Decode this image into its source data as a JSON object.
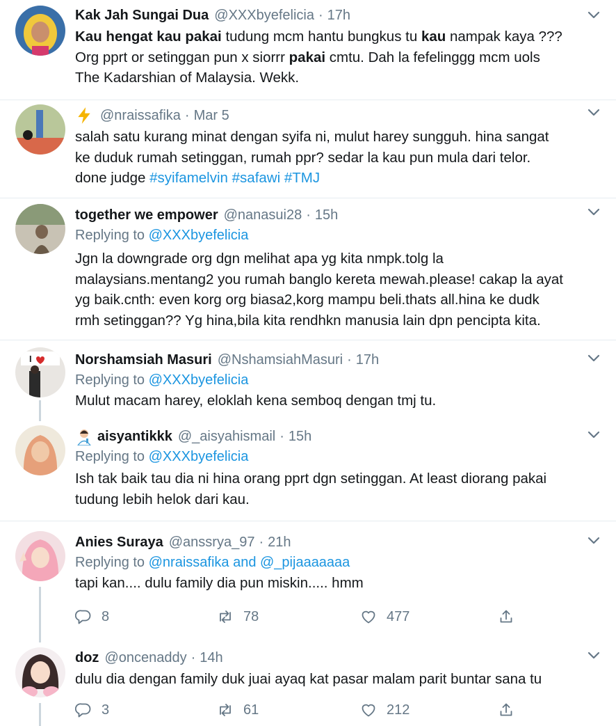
{
  "colors": {
    "link": "#1b95e0",
    "muted": "#657786",
    "text": "#14171a",
    "divider": "#e6ecf0"
  },
  "tweets": [
    {
      "name": "Kak Jah Sungai Dua",
      "handle": "@XXXbyefelicia",
      "sep": "·",
      "time": "17h",
      "text_parts": [
        "Kau hengat kau pakai",
        " tudung mcm hantu bungkus tu ",
        "kau",
        " nampak kaya ???",
        "Org pprt or setinggan pun x siorrr ",
        "pakai",
        " cmtu. Dah la fefelinggg mcm uols",
        "The Kadarshian of Malaysia. Wekk."
      ]
    },
    {
      "name_icon": "lightning-emoji",
      "handle": "@nraissafika",
      "sep": "·",
      "time": "Mar 5",
      "lines": [
        "salah satu kurang minat dengan syifa ni, mulut harey sungguh. hina sangat",
        "ke duduk rumah setinggan, rumah ppr? sedar la kau pun mula dari telor.",
        "done judge "
      ],
      "hashtags": [
        "#syifamelvin",
        "#safawi",
        "#TMJ"
      ]
    },
    {
      "name": "together we empower",
      "handle": "@nanasui28",
      "sep": "·",
      "time": "15h",
      "reply_prefix": "Replying to",
      "reply_to": "@XXXbyefelicia",
      "lines": [
        "Jgn la downgrade org dgn melihat apa yg kita nmpk.tolg la",
        "malaysians.mentang2 you rumah banglo kereta mewah.please! cakap la ayat",
        "yg baik.cnth: even korg org biasa2,korg mampu beli.thats all.hina ke dudk",
        "rmh setinggan?? Yg hina,bila kita rendhkn manusia lain dpn pencipta kita."
      ]
    },
    {
      "name": "Norshamsiah Masuri",
      "handle": "@NshamsiahMasuri",
      "sep": "·",
      "time": "17h",
      "reply_prefix": "Replying to",
      "reply_to": "@XXXbyefelicia",
      "lines": [
        "Mulut macam harey, eloklah kena semboq dengan tmj tu."
      ]
    },
    {
      "name_icon": "scientist-emoji",
      "name": "aisyantikkk",
      "handle": "@_aisyahismail",
      "sep": "·",
      "time": "15h",
      "reply_prefix": "Replying to",
      "reply_to": "@XXXbyefelicia",
      "lines": [
        "Ish tak baik tau dia ni hina orang pprt dgn setinggan. At least diorang pakai",
        "tudung lebih helok dari kau."
      ]
    },
    {
      "name": "Anies Suraya",
      "handle": "@anssrya_97",
      "sep": "·",
      "time": "21h",
      "reply_prefix": "Replying to",
      "reply_to": "@nraissafika and @_pijaaaaaaa",
      "lines": [
        "tapi kan.... dulu family dia pun miskin..... hmm"
      ],
      "stats": {
        "replies": "8",
        "retweets": "78",
        "likes": "477"
      }
    },
    {
      "name": "doz",
      "handle": "@oncenaddy",
      "sep": "·",
      "time": "14h",
      "lines": [
        "dulu dia dengan family duk juai ayaq kat pasar malam parit buntar sana tu"
      ],
      "stats": {
        "replies": "3",
        "retweets": "61",
        "likes": "212"
      }
    }
  ]
}
